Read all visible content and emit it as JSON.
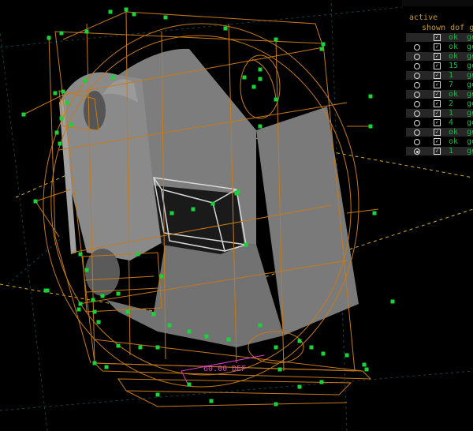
{
  "panel": {
    "header_active": "active",
    "header_columns": "shown dof ge",
    "rows": [
      {
        "radio": "",
        "dof": "ok",
        "ge": "ge"
      },
      {
        "radio": "○",
        "dof": "ok",
        "ge": "ge"
      },
      {
        "radio": "○",
        "dof": "ok",
        "ge": "ge"
      },
      {
        "radio": "○",
        "dof": "15",
        "ge": "ge"
      },
      {
        "radio": "○",
        "dof": "1",
        "ge": "ge"
      },
      {
        "radio": "○",
        "dof": "7",
        "ge": "ge"
      },
      {
        "radio": "○",
        "dof": "ok",
        "ge": "ge"
      },
      {
        "radio": "○",
        "dof": "2",
        "ge": "ge"
      },
      {
        "radio": "○",
        "dof": "1",
        "ge": "ge"
      },
      {
        "radio": "○",
        "dof": "4",
        "ge": "ge"
      },
      {
        "radio": "○",
        "dof": "ok",
        "ge": "ge"
      },
      {
        "radio": "○",
        "dof": "ok",
        "ge": "ge"
      },
      {
        "radio": "◉",
        "dof": "1",
        "ge": "ge"
      }
    ]
  },
  "viewport": {
    "dimension_label": "60.00 DEF",
    "colors": {
      "background": "#000000",
      "constraint": "#c77a18",
      "handle": "#17d43a",
      "face_light": "#8c8c8c",
      "face_dark": "#6a6a6a",
      "dimension": "#e040c0",
      "selection": "#c8c8c8",
      "axis": "#d8b020"
    }
  }
}
